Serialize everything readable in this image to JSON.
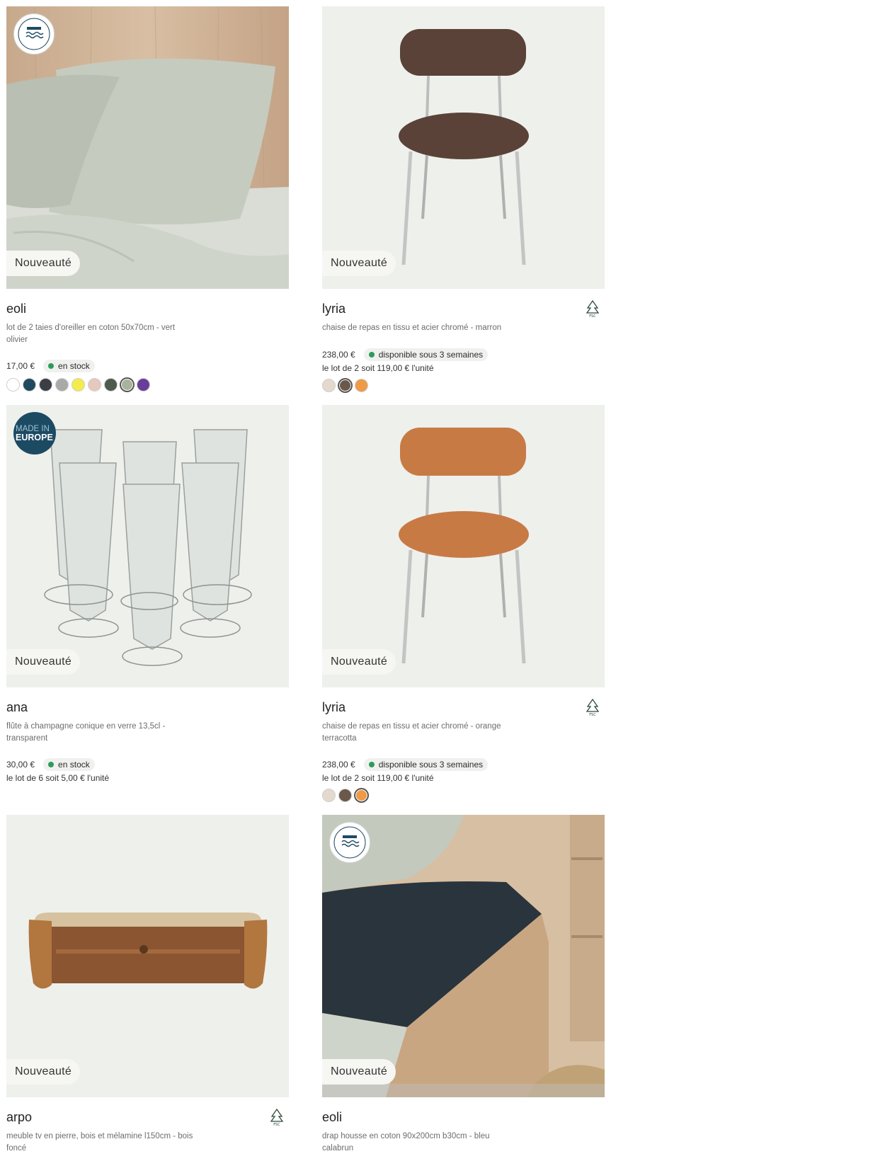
{
  "products": [
    {
      "badge": "Nouveauté",
      "name": "eoli",
      "description": "lot de 2 taies d'oreiller en coton 50x70cm - vert olivier",
      "price": "17,00 €",
      "availability": "en stock",
      "availability_color": "#2e9a5c",
      "label": "made-in-bassin-mediterraneen",
      "swatches": [
        "#ffffff",
        "#1f4a60",
        "#3b3e45",
        "#a9a9a9",
        "#f3ec4a",
        "#e7c8bd",
        "#4d5a4c",
        "#a9b29a",
        "#6a3d9a"
      ],
      "selected_swatch": 7
    },
    {
      "badge": "Nouveauté",
      "name": "lyria",
      "description": "chaise de repas en tissu et acier chromé - marron",
      "price": "238,00 €",
      "availability": "disponible sous 3 semaines",
      "availability_color": "#2e9a5c",
      "lot": "le lot de 2 soit 119,00 € l'unité",
      "eco_label": "fsc-icon",
      "swatches": [
        "#e3d9cc",
        "#6a584b",
        "#ee9a47"
      ],
      "selected_swatch": 1
    },
    {
      "badge": "Nouveauté",
      "name": "ana",
      "description": "flûte à champagne conique en verre 13,5cl - transparent",
      "price": "30,00 €",
      "availability": "en stock",
      "availability_color": "#2e9a5c",
      "lot": "le lot de 6 soit 5,00 € l'unité",
      "label_lines": [
        "MADE IN",
        "EUROPE"
      ]
    },
    {
      "badge": "Nouveauté",
      "name": "lyria",
      "description": "chaise de repas en tissu et acier chromé - orange terracotta",
      "price": "238,00 €",
      "availability": "disponible sous 3 semaines",
      "availability_color": "#2e9a5c",
      "lot": "le lot de 2 soit 119,00 € l'unité",
      "eco_label": "fsc-icon",
      "swatches": [
        "#e3d9cc",
        "#6a584b",
        "#ee9a47"
      ],
      "selected_swatch": 2
    },
    {
      "badge": "Nouveauté",
      "name": "arpo",
      "description": "meuble tv en pierre, bois et mélamine l150cm - bois foncé",
      "eco_label": "fsc-icon"
    },
    {
      "badge": "Nouveauté",
      "name": "eoli",
      "description": "drap housse en coton 90x200cm b30cm - bleu calabrun",
      "label": "made-in-bassin-mediterraneen"
    }
  ]
}
